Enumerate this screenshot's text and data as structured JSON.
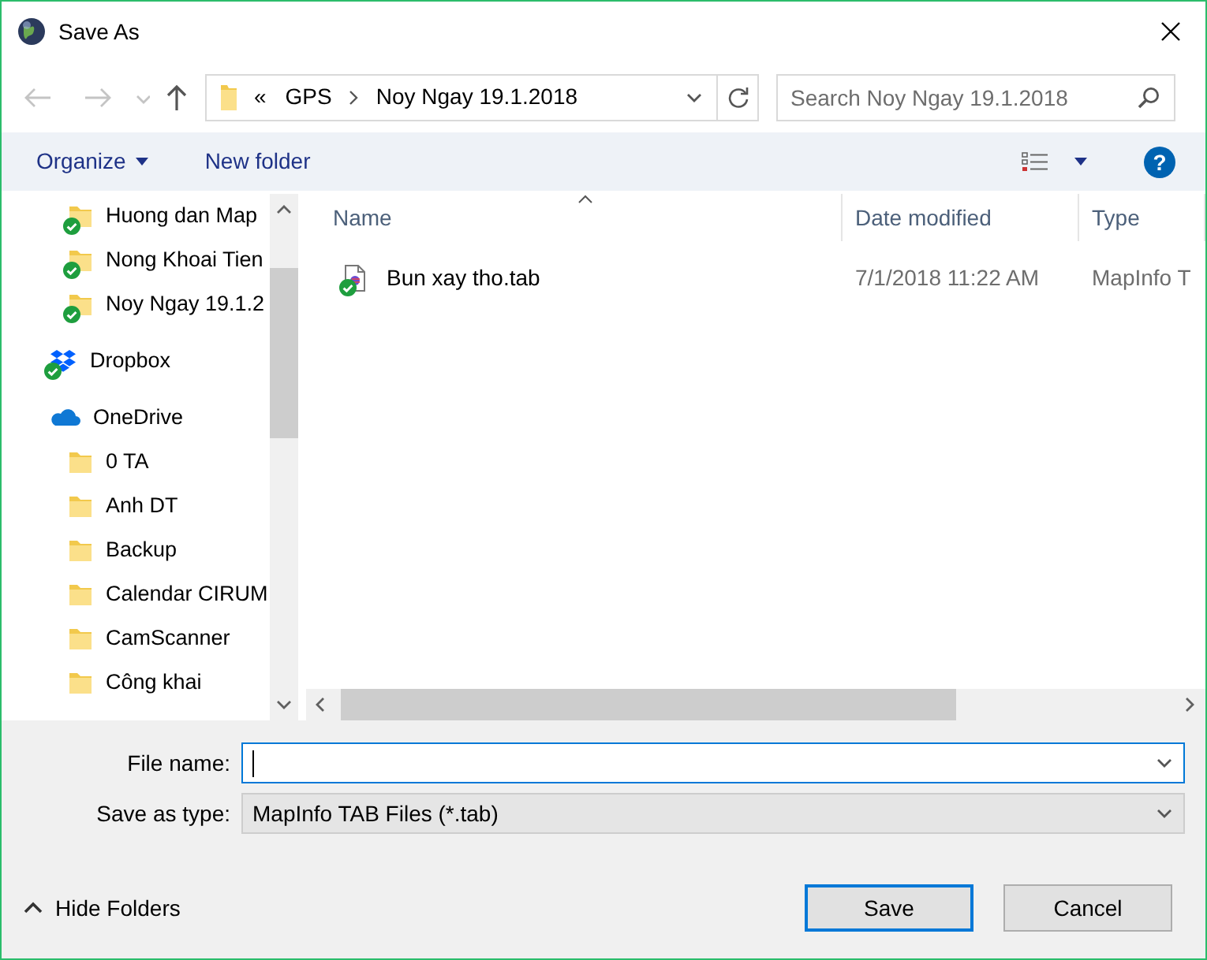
{
  "window": {
    "title": "Save As"
  },
  "navigation": {
    "back": {
      "disabled": true
    },
    "forward": {
      "disabled": true
    },
    "recent": {
      "disabled": true
    },
    "up": {
      "disabled": false
    }
  },
  "address_bar": {
    "overflow_mark": "«",
    "segments": [
      "GPS",
      "Noy Ngay 19.1.2018"
    ]
  },
  "search": {
    "placeholder": "Search Noy Ngay 19.1.2018"
  },
  "toolbar": {
    "organize": "Organize",
    "new_folder": "New folder",
    "help": "?"
  },
  "sidebar": {
    "continued_children": [
      {
        "kind": "folder",
        "label": "Huong dan Map",
        "synced": true
      },
      {
        "kind": "folder",
        "label": "Nong Khoai Tien",
        "synced": true
      },
      {
        "kind": "folder",
        "label": "Noy Ngay 19.1.2",
        "synced": true
      }
    ],
    "items": [
      {
        "kind": "dropbox",
        "label": "Dropbox",
        "synced": true
      },
      {
        "kind": "onedrive",
        "label": "OneDrive",
        "synced": false,
        "children": [
          {
            "kind": "folder",
            "label": "0 TA",
            "synced": false
          },
          {
            "kind": "folder",
            "label": "Anh DT",
            "synced": false
          },
          {
            "kind": "folder",
            "label": "Backup",
            "synced": false
          },
          {
            "kind": "folder",
            "label": "Calendar CIRUM",
            "synced": false
          },
          {
            "kind": "folder",
            "label": "CamScanner",
            "synced": false
          },
          {
            "kind": "folder",
            "label": "Công khai",
            "synced": false
          }
        ]
      }
    ]
  },
  "file_list": {
    "columns": [
      {
        "label": "Name",
        "sorted": true
      },
      {
        "label": "Date modified",
        "sorted": false
      },
      {
        "label": "Type",
        "sorted": false
      }
    ],
    "rows": [
      {
        "name": "Bun xay tho.tab",
        "date_modified": "7/1/2018 11:22 AM",
        "type": "MapInfo T",
        "synced": true
      }
    ]
  },
  "form": {
    "file_name": {
      "label": "File name:",
      "focused": true
    },
    "save_as_type": {
      "label": "Save as type:",
      "value": "MapInfo TAB Files (*.tab)"
    }
  },
  "hide_folders": "Hide Folders",
  "buttons": [
    {
      "label": "Save",
      "default": true
    },
    {
      "label": "Cancel",
      "default": false
    }
  ]
}
